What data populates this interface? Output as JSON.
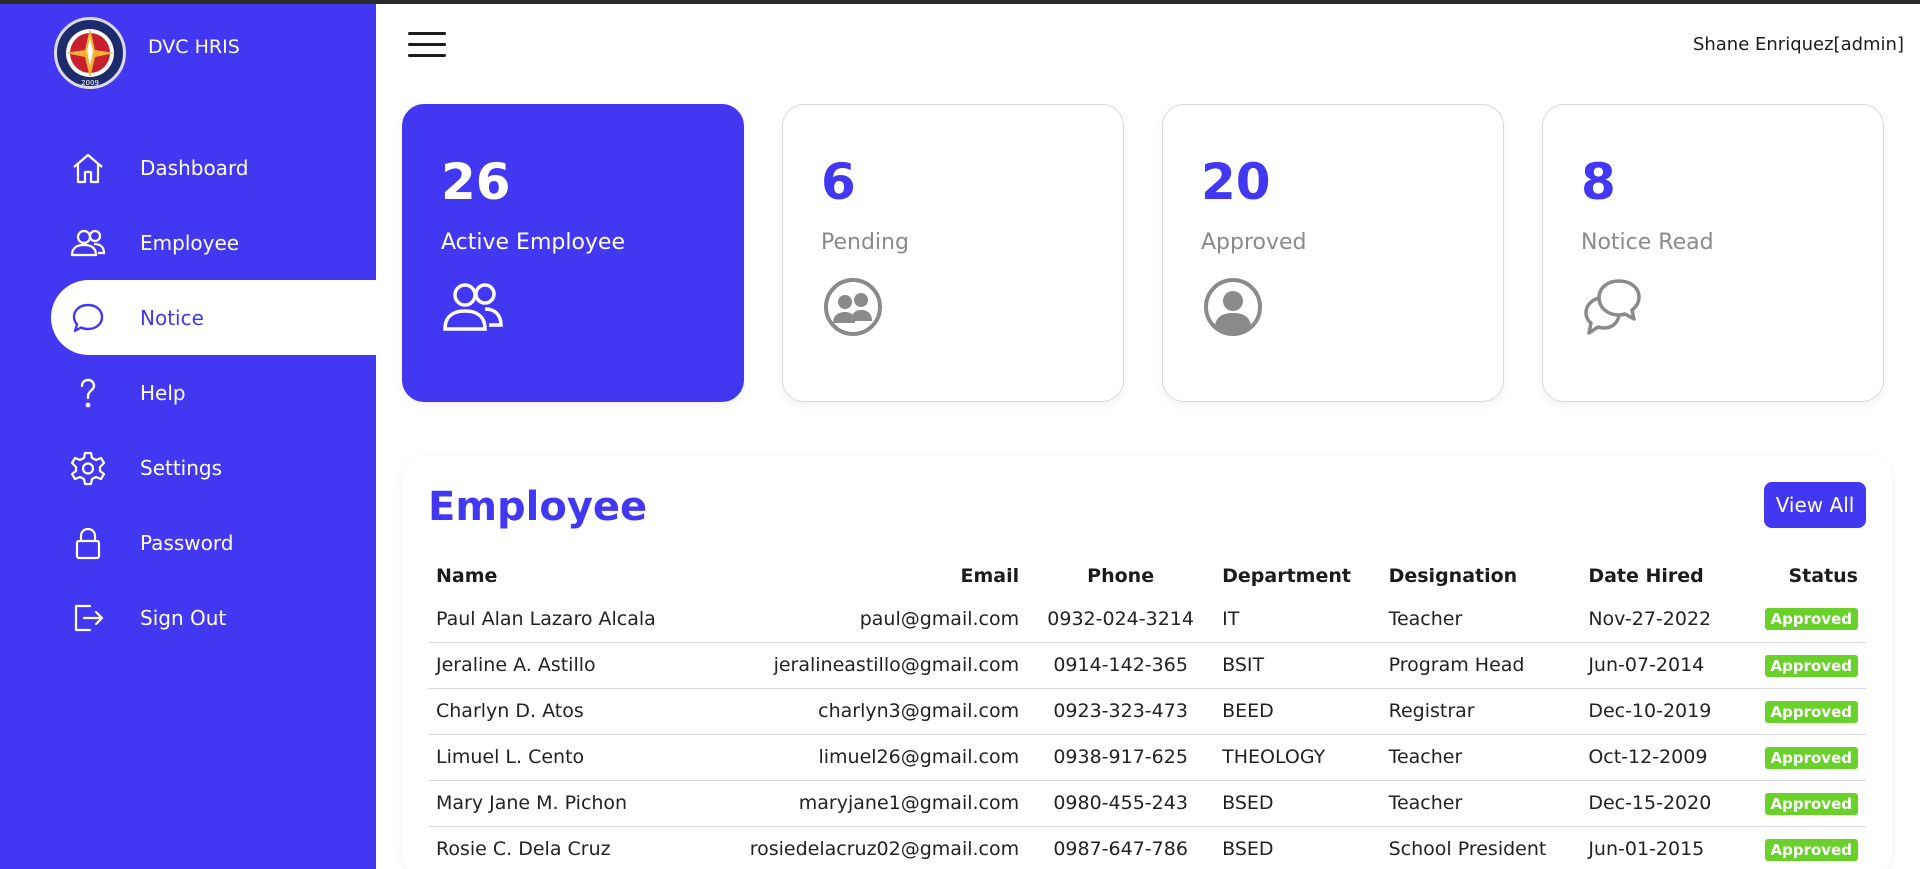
{
  "app": {
    "name": "DVC HRIS",
    "logo_year": "2009"
  },
  "header": {
    "user": "Shane Enriquez[admin]"
  },
  "sidebar": {
    "items": [
      {
        "label": "Dashboard",
        "icon": "home-icon"
      },
      {
        "label": "Employee",
        "icon": "users-icon"
      },
      {
        "label": "Notice",
        "icon": "chat-icon",
        "active": true
      },
      {
        "label": "Help",
        "icon": "question-icon"
      },
      {
        "label": "Settings",
        "icon": "gear-icon"
      },
      {
        "label": "Password",
        "icon": "lock-icon"
      },
      {
        "label": "Sign Out",
        "icon": "sign-out-icon"
      }
    ]
  },
  "cards": [
    {
      "value": "26",
      "label": "Active Employee",
      "icon": "users-icon"
    },
    {
      "value": "6",
      "label": "Pending",
      "icon": "pending-users-icon"
    },
    {
      "value": "20",
      "label": "Approved",
      "icon": "user-circle-icon"
    },
    {
      "value": "8",
      "label": "Notice Read",
      "icon": "chat-bubbles-icon"
    }
  ],
  "employees": {
    "title": "Employee",
    "view_all": "View All",
    "columns": [
      "Name",
      "Email",
      "Phone",
      "Department",
      "Designation",
      "Date Hired",
      "Status"
    ],
    "rows": [
      {
        "name": "Paul Alan Lazaro Alcala",
        "email": "paul@gmail.com",
        "phone": "0932-024-3214",
        "department": "IT",
        "designation": "Teacher",
        "date_hired": "Nov-27-2022",
        "status": "Approved"
      },
      {
        "name": "Jeraline A. Astillo",
        "email": "jeralineastillo@gmail.com",
        "phone": "0914-142-365",
        "department": "BSIT",
        "designation": "Program Head",
        "date_hired": "Jun-07-2014",
        "status": "Approved"
      },
      {
        "name": "Charlyn D. Atos",
        "email": "charlyn3@gmail.com",
        "phone": "0923-323-473",
        "department": "BEED",
        "designation": "Registrar",
        "date_hired": "Dec-10-2019",
        "status": "Approved"
      },
      {
        "name": "Limuel L. Cento",
        "email": "limuel26@gmail.com",
        "phone": "0938-917-625",
        "department": "THEOLOGY",
        "designation": "Teacher",
        "date_hired": "Oct-12-2009",
        "status": "Approved"
      },
      {
        "name": "Mary Jane M. Pichon",
        "email": "maryjane1@gmail.com",
        "phone": "0980-455-243",
        "department": "BSED",
        "designation": "Teacher",
        "date_hired": "Dec-15-2020",
        "status": "Approved"
      },
      {
        "name": "Rosie C. Dela Cruz",
        "email": "rosiedelacruz02@gmail.com",
        "phone": "0987-647-786",
        "department": "BSED",
        "designation": "School President",
        "date_hired": "Jun-01-2015",
        "status": "Approved"
      }
    ]
  },
  "colors": {
    "accent": "#4338f2",
    "status_approved": "#6ad12b",
    "muted_text": "#8a8a8a"
  }
}
